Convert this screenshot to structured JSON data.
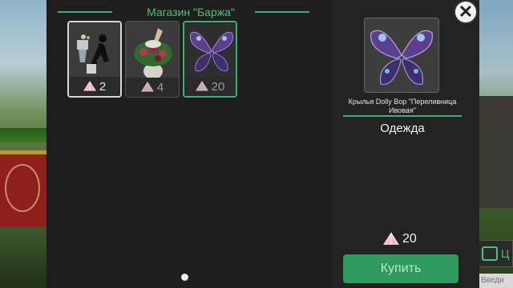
{
  "shop": {
    "title": "Магазин \"Баржа\"",
    "items": [
      {
        "name": "mannequin-accessory-item",
        "price": "2",
        "selected": "white"
      },
      {
        "name": "flower-hat-item",
        "price": "4",
        "selected": "none"
      },
      {
        "name": "butterfly-wings-item",
        "price": "20",
        "selected": "green"
      }
    ],
    "page_indicator": "1"
  },
  "detail": {
    "item_name": "Крылья Dolly Bop \"Переливница Ивовая\"",
    "category": "Одежда",
    "price": "20",
    "buy_label": "Купить"
  },
  "hud": {
    "chat_label": "Ц",
    "chat_placeholder": "Введи"
  },
  "colors": {
    "accent_green": "#3fb06c",
    "buy_button": "#2f9a5c",
    "panel_bg": "#1e1e1e"
  },
  "icons": [
    "gem-icon",
    "close-icon",
    "chat-icon"
  ]
}
